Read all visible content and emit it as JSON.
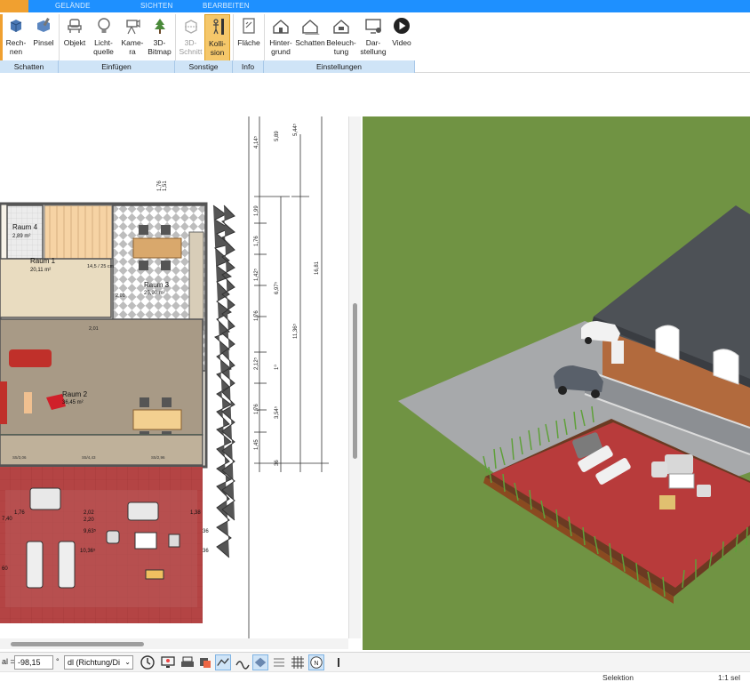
{
  "ribbon": {
    "tabs": [
      "GELÄNDE",
      "SICHTEN",
      "BEARBEITEN"
    ],
    "buttons": {
      "rechnen": "Rech-\nnen",
      "pinsel": "Pinsel",
      "objekt": "Objekt",
      "lichtquelle": "Licht-\nquelle",
      "kamera": "Kame-\nra",
      "bitmap3d": "3D-\nBitmap",
      "schnitt3d": "3D-\nSchnitt",
      "kollision": "Kolli-\nsion",
      "flaeche": "Fläche",
      "hintergrund": "Hinter-\ngrund",
      "schatten": "Schatten",
      "beleuchtung": "Beleuch-\ntung",
      "darstellung": "Dar-\nstellung",
      "video": "Video"
    },
    "groups": {
      "schatten": "Schatten",
      "einfuegen": "Einfügen",
      "sonstige": "Sonstige",
      "info": "Info",
      "einstellungen": "Einstellungen"
    }
  },
  "plan": {
    "rooms": [
      {
        "name": "Raum 4",
        "area": "2,89 m²"
      },
      {
        "name": "Raum 1",
        "area": "20,11 m²"
      },
      {
        "name": "Raum 3",
        "area": "25,90 m²"
      },
      {
        "name": "Raum 2",
        "area": "36,45 m²"
      }
    ],
    "dims_right": [
      "4,14⁵",
      "5,89",
      "5,44⁵",
      "1,99",
      "1,76",
      "1,42⁵",
      "6,97⁵",
      "1,76",
      "11,36⁵",
      "16,81",
      "2,12⁵",
      "1⁰",
      "1,76",
      "3,54⁵",
      "1,45",
      "36"
    ],
    "dims_top": [
      "1,76",
      "1,51"
    ],
    "dims_misc": [
      "2,01",
      "2,01",
      "14,5 / 25 cm",
      "7,40",
      "1,76",
      "2,02",
      "1,38",
      "2,20",
      "9,63⁵",
      "10,36⁵",
      "36",
      "36",
      "60",
      "S5/3,06",
      "S5/4,43",
      "S5/2,96"
    ]
  },
  "bottombar": {
    "angle_label": "al =",
    "angle_value": "-98,15",
    "degree": "°",
    "direction_select": "dl (Richtung/Di"
  },
  "status": {
    "mode": "Selektion",
    "scale": "1:1 sel"
  },
  "colors": {
    "accent": "#1e90ff",
    "group_bar": "#cfe4f7",
    "active_button": "#f5c76a",
    "grass": "#6b8f3f",
    "terrace": "#b83b3b",
    "roof": "#4d5156",
    "brick": "#b26a3d"
  },
  "icons": [
    "rechnen-icon",
    "pinsel-icon",
    "objekt-icon",
    "lichtquelle-icon",
    "kamera-icon",
    "bitmap-icon",
    "schnitt-icon",
    "kollision-icon",
    "flaeche-icon",
    "hintergrund-icon",
    "schatten-icon",
    "beleuchtung-icon",
    "darstellung-icon",
    "video-icon",
    "clock-icon",
    "screen-icon",
    "printer-icon",
    "layers-icon",
    "north-icon",
    "grid-icon"
  ]
}
